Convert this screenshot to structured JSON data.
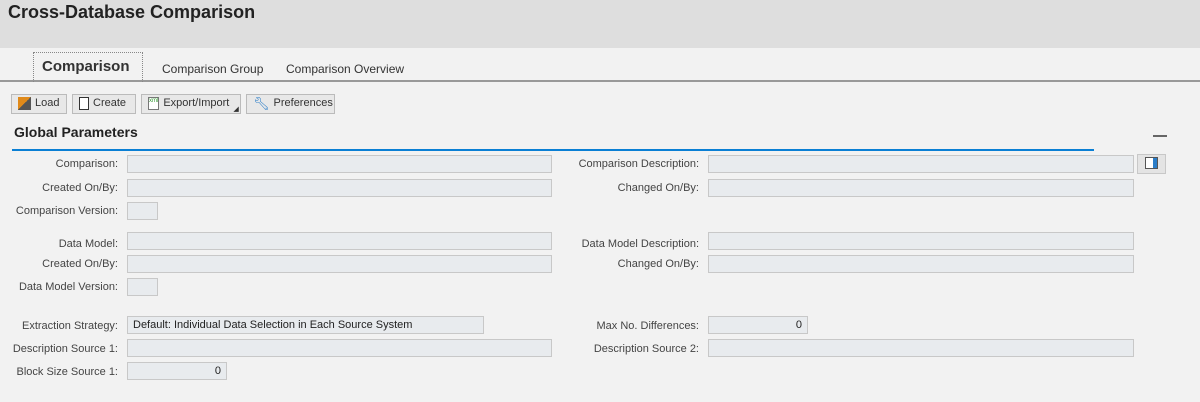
{
  "title": "Cross-Database Comparison",
  "tabs": [
    {
      "label": "Comparison",
      "active": true
    },
    {
      "label": "Comparison Group"
    },
    {
      "label": "Comparison Overview"
    }
  ],
  "toolbar": {
    "load": "Load",
    "create": "Create",
    "export_import": "Export/Import",
    "preferences": "Preferences"
  },
  "section": {
    "title": "Global Parameters"
  },
  "fields": {
    "comparison": {
      "label": "Comparison:",
      "value": ""
    },
    "comparison_description": {
      "label": "Comparison Description:",
      "value": ""
    },
    "created_on_by_1": {
      "label": "Created On/By:",
      "value": ""
    },
    "changed_on_by_1": {
      "label": "Changed On/By:",
      "value": ""
    },
    "comparison_version": {
      "label": "Comparison Version:",
      "value": ""
    },
    "data_model": {
      "label": "Data Model:",
      "value": ""
    },
    "data_model_description": {
      "label": "Data Model Description:",
      "value": ""
    },
    "created_on_by_2": {
      "label": "Created On/By:",
      "value": ""
    },
    "changed_on_by_2": {
      "label": "Changed On/By:",
      "value": ""
    },
    "data_model_version": {
      "label": "Data Model Version:",
      "value": ""
    },
    "extraction_strategy": {
      "label": "Extraction Strategy:",
      "value": "Default: Individual Data Selection in Each Source System"
    },
    "max_no_differences": {
      "label": "Max No. Differences:",
      "value": "0"
    },
    "description_source_1": {
      "label": "Description Source 1:",
      "value": ""
    },
    "description_source_2": {
      "label": "Description Source 2:",
      "value": ""
    },
    "block_size_source_1": {
      "label": "Block Size Source 1:",
      "value": "0"
    }
  },
  "colors": {
    "accent": "#0a7fd4"
  }
}
